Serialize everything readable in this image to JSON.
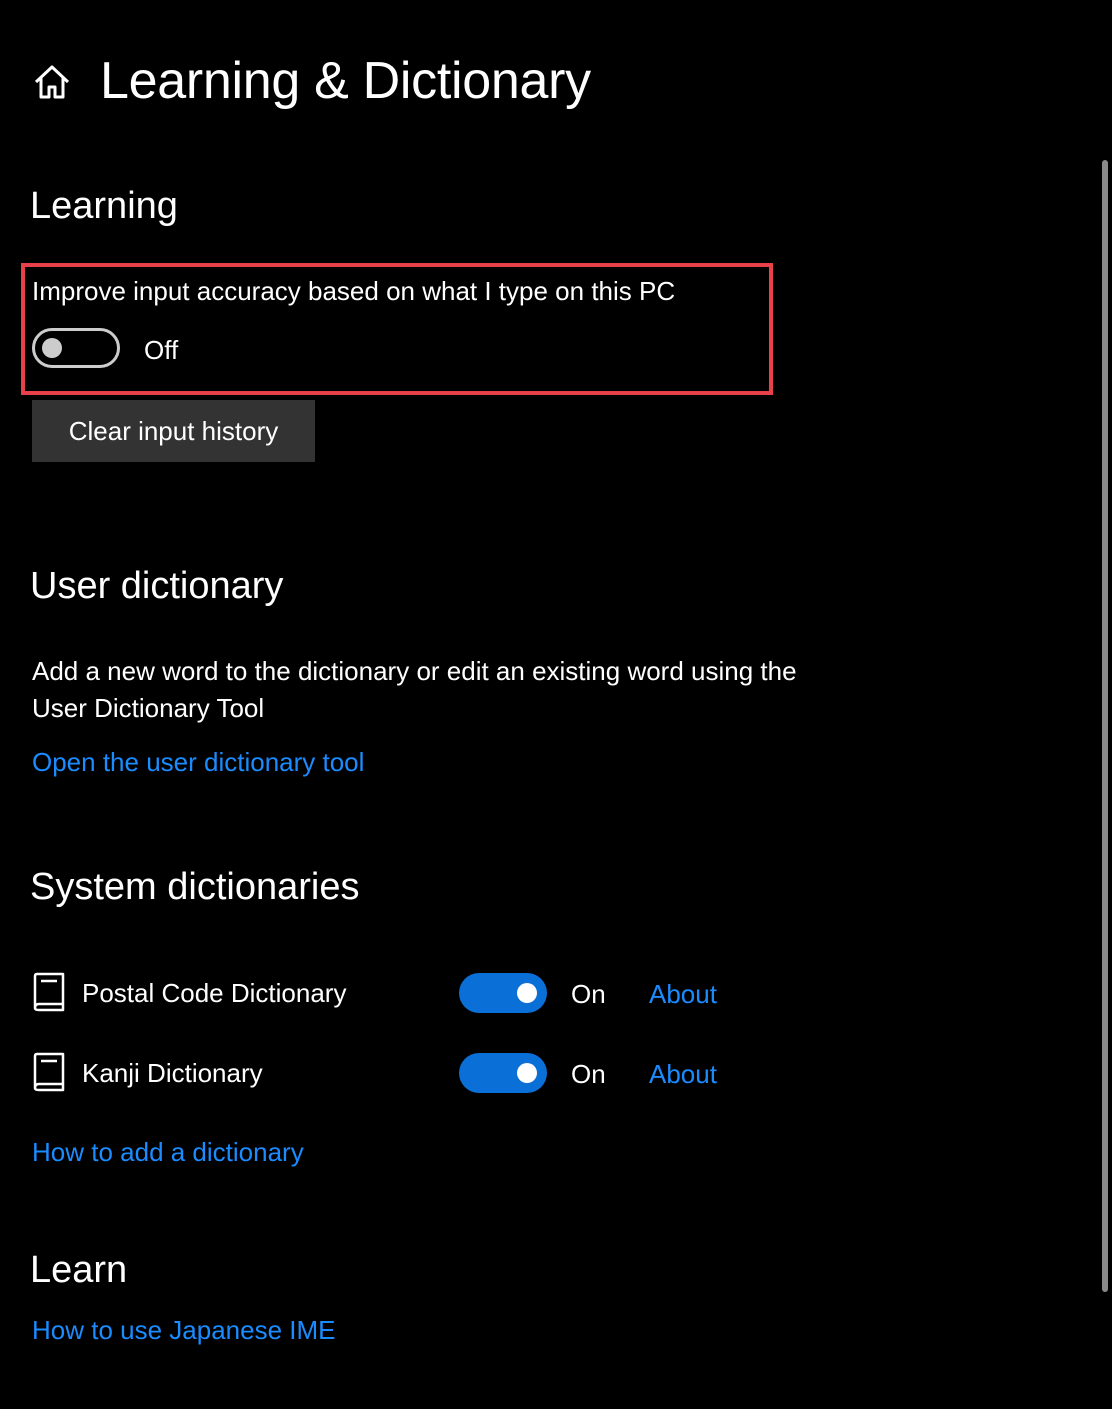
{
  "header": {
    "home_icon": "home-icon",
    "title": "Learning & Dictionary"
  },
  "learning": {
    "heading": "Learning",
    "improve_label": "Improve input accuracy based on what I type on this PC",
    "improve_toggle": {
      "state": "off",
      "label": "Off"
    },
    "clear_button": "Clear input history",
    "highlight_color": "#e8414a"
  },
  "user_dictionary": {
    "heading": "User dictionary",
    "description_line1": "Add a new word to the dictionary or edit an existing word using the",
    "description_line2": "User Dictionary Tool",
    "open_link": "Open the user dictionary tool"
  },
  "system_dictionaries": {
    "heading": "System dictionaries",
    "items": [
      {
        "icon": "book-icon",
        "name": "Postal Code Dictionary",
        "state": "on",
        "state_label": "On",
        "about": "About"
      },
      {
        "icon": "book-icon",
        "name": "Kanji Dictionary",
        "state": "on",
        "state_label": "On",
        "about": "About"
      }
    ],
    "add_link": "How to add a dictionary"
  },
  "learn": {
    "heading": "Learn",
    "ime_link": "How to use Japanese IME"
  },
  "colors": {
    "background": "#000000",
    "text": "#ffffff",
    "link": "#1a8cff",
    "toggle_on": "#0a6fd6",
    "button_bg": "#333333"
  }
}
